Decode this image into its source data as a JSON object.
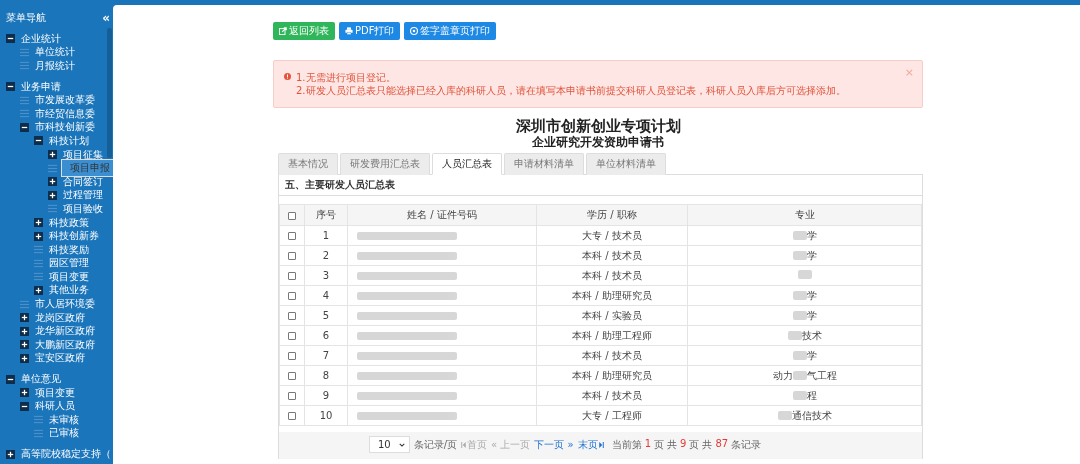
{
  "sidebar": {
    "title": "菜单导航",
    "collapse": "«",
    "items": [
      {
        "label": "企业统计",
        "expanded": true,
        "selected": false,
        "children": [
          {
            "label": "单位统计",
            "selected": false
          },
          {
            "label": "月报统计",
            "selected": false
          }
        ]
      },
      {
        "label": "业务申请",
        "expanded": true,
        "selected": false,
        "children": [
          {
            "label": "市发展改革委",
            "selected": false
          },
          {
            "label": "市经贸信息委",
            "selected": false
          },
          {
            "label": "市科技创新委",
            "expanded": true,
            "selected": false,
            "children": [
              {
                "label": "科技计划",
                "expanded": true,
                "selected": false,
                "children": [
                  {
                    "label": "项目征集",
                    "expanded": false,
                    "selected": false
                  },
                  {
                    "label": "项目申报",
                    "selected": true
                  },
                  {
                    "label": "合同签订",
                    "expanded": false,
                    "selected": false
                  },
                  {
                    "label": "过程管理",
                    "expanded": false,
                    "selected": false
                  },
                  {
                    "label": "项目验收",
                    "selected": false
                  }
                ]
              },
              {
                "label": "科技政策",
                "expanded": false,
                "selected": false
              },
              {
                "label": "科技创新券",
                "expanded": false,
                "selected": false
              },
              {
                "label": "科技奖励",
                "selected": false
              },
              {
                "label": "园区管理",
                "selected": false
              },
              {
                "label": "项目变更",
                "selected": false
              },
              {
                "label": "其他业务",
                "expanded": false,
                "selected": false
              }
            ]
          },
          {
            "label": "市人居环境委",
            "selected": false
          },
          {
            "label": "龙岗区政府",
            "expanded": false,
            "selected": false
          },
          {
            "label": "龙华新区政府",
            "expanded": false,
            "selected": false
          },
          {
            "label": "大鹏新区政府",
            "expanded": false,
            "selected": false
          },
          {
            "label": "宝安区政府",
            "expanded": false,
            "selected": false
          }
        ]
      },
      {
        "label": "单位意见",
        "expanded": true,
        "selected": false,
        "children": [
          {
            "label": "项目变更",
            "expanded": false,
            "selected": false
          },
          {
            "label": "科研人员",
            "expanded": true,
            "selected": false,
            "children": [
              {
                "label": "未审核",
                "selected": false
              },
              {
                "label": "已审核",
                "selected": false
              }
            ]
          }
        ]
      },
      {
        "label": "高等院校稳定支持（",
        "expanded": false,
        "selected": false
      }
    ]
  },
  "toolbar": [
    {
      "label": "返回列表",
      "kind": "back"
    },
    {
      "label": "PDF打印",
      "kind": "print"
    },
    {
      "label": "签字盖章页打印",
      "kind": "stamp"
    }
  ],
  "alert": {
    "lines": [
      "1.无需进行项目登记。",
      "2.研发人员汇总表只能选择已经入库的科研人员，请在填写本申请书前提交科研人员登记表，科研人员入库后方可选择添加。"
    ],
    "close": "×"
  },
  "title": "深圳市创新创业专项计划",
  "subtitle": "企业研究开发资助申请书",
  "tabs": [
    {
      "label": "基本情况",
      "selected": false
    },
    {
      "label": "研发费用汇总表",
      "selected": false
    },
    {
      "label": "人员汇总表",
      "selected": true
    },
    {
      "label": "申请材料清单",
      "selected": false
    },
    {
      "label": "单位材料清单",
      "selected": false
    }
  ],
  "panel_title": "五、主要研发人员汇总表",
  "table": {
    "all_checked": false,
    "columns": [
      "序号",
      "姓名 / 证件号码",
      "学历 / 职称",
      "专业"
    ],
    "rows": [
      {
        "checked": false,
        "no": "1",
        "degree": "大专 / 技术员",
        "major_end": "学"
      },
      {
        "checked": false,
        "no": "2",
        "degree": "本科 / 技术员",
        "major_end": "学"
      },
      {
        "checked": false,
        "no": "3",
        "degree": "本科 / 技术员"
      },
      {
        "checked": false,
        "no": "4",
        "degree": "本科 / 助理研究员",
        "major_end": "学"
      },
      {
        "checked": false,
        "no": "5",
        "degree": "本科 / 实验员",
        "major_end": "学"
      },
      {
        "checked": false,
        "no": "6",
        "degree": "本科 / 助理工程师",
        "major_end": "技术"
      },
      {
        "checked": false,
        "no": "7",
        "degree": "本科 / 技术员",
        "major_end": "学"
      },
      {
        "checked": false,
        "no": "8",
        "degree": "本科 / 助理研究员",
        "major_start": "动力",
        "major_end": "气工程"
      },
      {
        "checked": false,
        "no": "9",
        "degree": "本科 / 技术员",
        "major_end": "程"
      },
      {
        "checked": false,
        "no": "10",
        "degree": "大专 / 工程师",
        "major_end": "通信技术"
      }
    ]
  },
  "pager": {
    "page_size": "10",
    "per_page_label": "条记录/页",
    "nav": [
      {
        "label": "首页",
        "kind": "first",
        "disabled": true
      },
      {
        "label": "« 上一页",
        "kind": "prev",
        "disabled": true
      },
      {
        "label": "下一页 »",
        "kind": "next",
        "disabled": false
      },
      {
        "label": "末页",
        "kind": "last",
        "disabled": false
      }
    ],
    "info": [
      {
        "text": "当前第",
        "kind": "label"
      },
      {
        "text": "1",
        "kind": "number"
      },
      {
        "text": "页",
        "kind": "label"
      },
      {
        "text": "共",
        "kind": "label"
      },
      {
        "text": "9",
        "kind": "number"
      },
      {
        "text": "页",
        "kind": "label"
      },
      {
        "text": "共",
        "kind": "label"
      },
      {
        "text": "87",
        "kind": "number"
      },
      {
        "text": "条记录",
        "kind": "label"
      }
    ]
  }
}
